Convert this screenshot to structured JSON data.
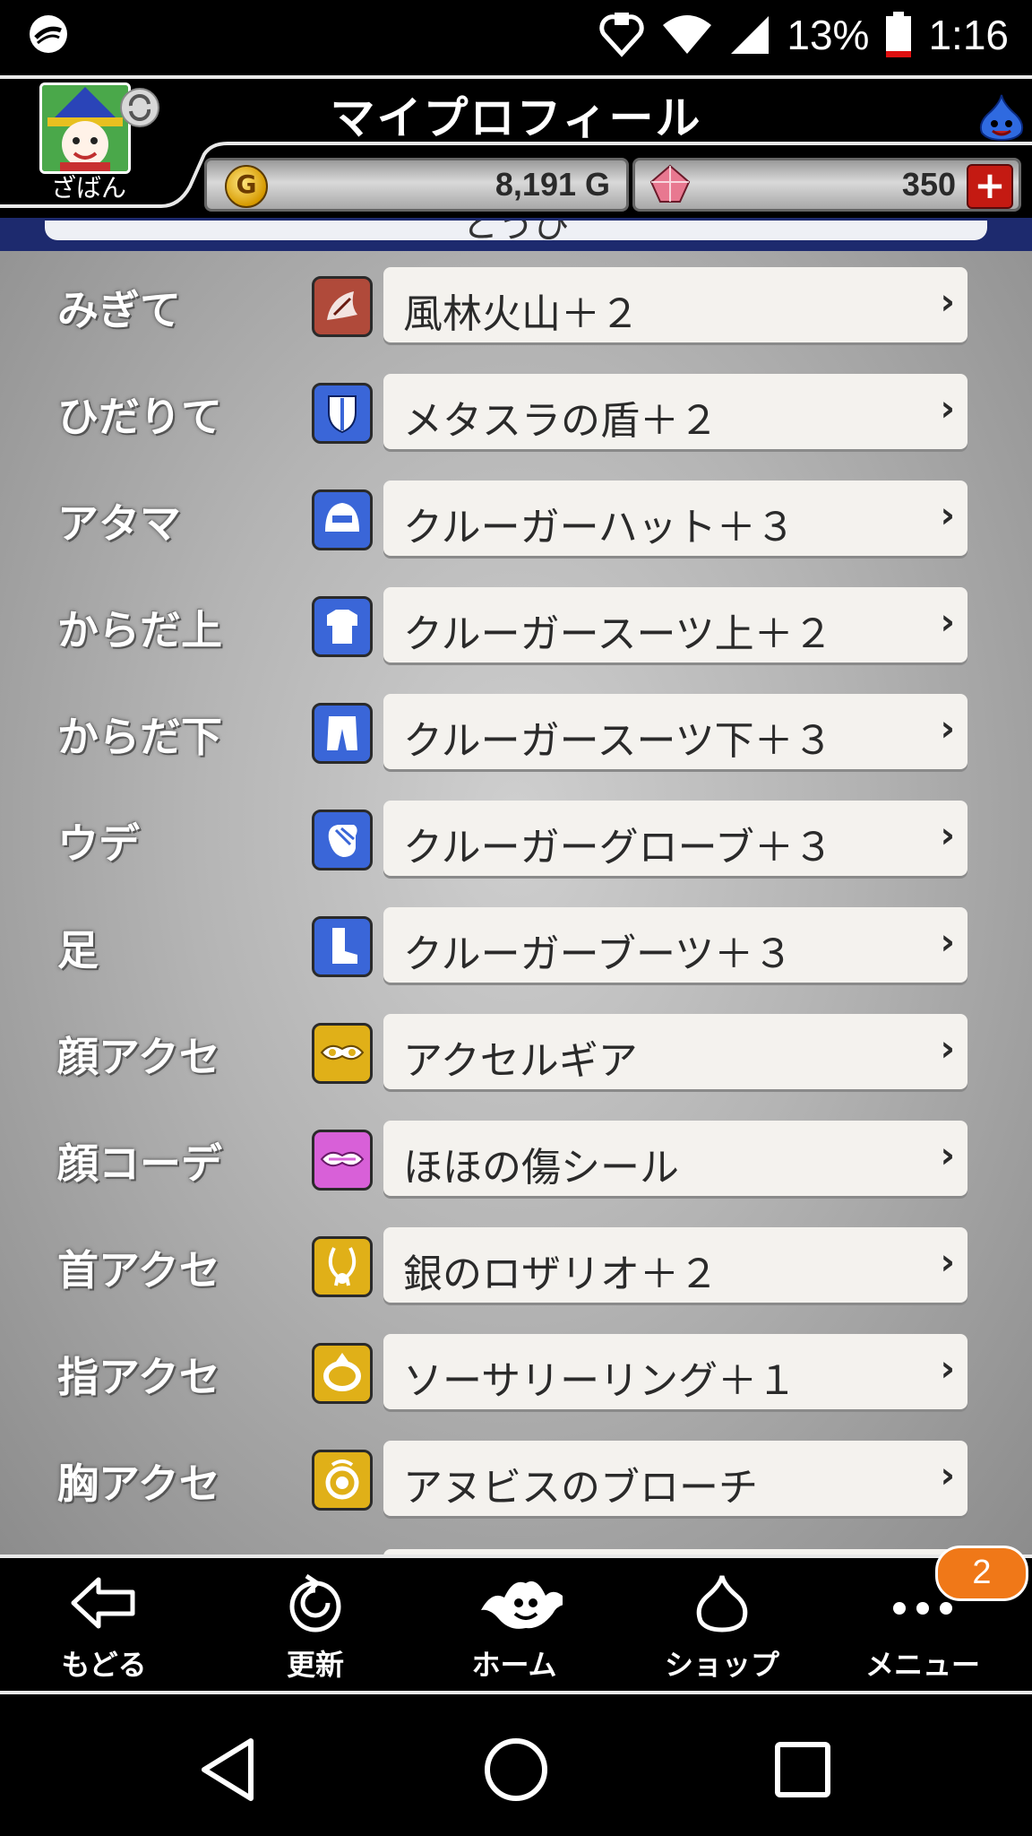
{
  "status_bar": {
    "battery": "13%",
    "time": "1:16"
  },
  "header": {
    "title": "マイプロフィール",
    "username": "ざばん",
    "gold": "8,191 G",
    "gold_icon_letter": "G",
    "gems": "350",
    "plus": "+"
  },
  "section": {
    "partial_title": "とうび"
  },
  "equipment": [
    {
      "slot": "みぎて",
      "item": "風林火山＋２",
      "icon": "weapon-icon",
      "icon_color": "#b04a3a"
    },
    {
      "slot": "ひだりて",
      "item": "メタスラの盾＋２",
      "icon": "shield-icon",
      "icon_color": "#3a66d8"
    },
    {
      "slot": "アタマ",
      "item": "クルーガーハット＋３",
      "icon": "helmet-icon",
      "icon_color": "#3a66d8"
    },
    {
      "slot": "からだ上",
      "item": "クルーガースーツ上＋２",
      "icon": "body-top-icon",
      "icon_color": "#3a66d8"
    },
    {
      "slot": "からだ下",
      "item": "クルーガースーツ下＋３",
      "icon": "body-bottom-icon",
      "icon_color": "#3a66d8"
    },
    {
      "slot": "ウデ",
      "item": "クルーガーグローブ＋３",
      "icon": "glove-icon",
      "icon_color": "#3a66d8"
    },
    {
      "slot": "足",
      "item": "クルーガーブーツ＋３",
      "icon": "boot-icon",
      "icon_color": "#3a66d8"
    },
    {
      "slot": "顔アクセ",
      "item": "アクセルギア",
      "icon": "face-accessory-icon",
      "icon_color": "#e0b018"
    },
    {
      "slot": "顔コーデ",
      "item": "ほほの傷シール",
      "icon": "face-coordinate-icon",
      "icon_color": "#d860d8"
    },
    {
      "slot": "首アクセ",
      "item": "銀のロザリオ＋２",
      "icon": "necklace-icon",
      "icon_color": "#e0b018"
    },
    {
      "slot": "指アクセ",
      "item": "ソーサリーリング＋１",
      "icon": "ring-icon",
      "icon_color": "#e0b018"
    },
    {
      "slot": "胸アクセ",
      "item": "アヌビスのブローチ",
      "icon": "brooch-icon",
      "icon_color": "#e0b018"
    }
  ],
  "chevron": "›",
  "bottom_nav": [
    {
      "label": "もどる",
      "icon": "back-arrow-icon"
    },
    {
      "label": "更新",
      "icon": "refresh-icon"
    },
    {
      "label": "ホーム",
      "icon": "home-monster-icon"
    },
    {
      "label": "ショップ",
      "icon": "shop-slime-icon"
    },
    {
      "label": "メニュー",
      "icon": "menu-dots-icon"
    }
  ],
  "menu_badge": "2"
}
